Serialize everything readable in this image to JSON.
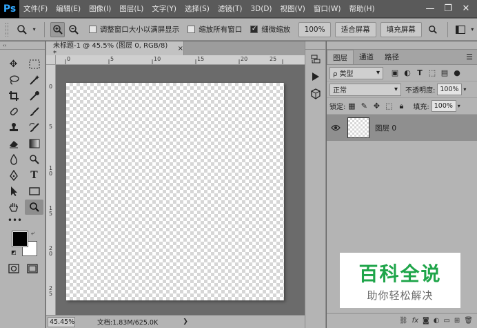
{
  "app": {
    "logo": "Ps"
  },
  "menu": [
    "文件(F)",
    "编辑(E)",
    "图像(I)",
    "图层(L)",
    "文字(Y)",
    "选择(S)",
    "滤镜(T)",
    "3D(D)",
    "视图(V)",
    "窗口(W)",
    "帮助(H)"
  ],
  "window_controls": {
    "minimize": "—",
    "restore": "❐",
    "close": "✕"
  },
  "options": {
    "resize_windows_label": "调整窗口大小以满屏显示",
    "resize_windows_checked": false,
    "zoom_all_label": "缩放所有窗口",
    "zoom_all_checked": false,
    "scrubby_zoom_label": "细微缩放",
    "scrubby_zoom_checked": true,
    "percent_button": "100%",
    "fit_screen_button": "适合屏幕",
    "fill_screen_button": "填充屏幕"
  },
  "document": {
    "tab_title": "未标题-1 @ 45.5% (图层 0, RGB/8) *",
    "tab_close": "×",
    "ruler_top": [
      "0",
      "5",
      "10",
      "15",
      "20",
      "25"
    ],
    "ruler_left": [
      "0",
      "5",
      "1\n0",
      "1\n5",
      "2\n0",
      "2\n5"
    ],
    "zoom": "45.45%",
    "doc_info": "文档:1.83M/625.0K",
    "status_arrow": "❯"
  },
  "layers_panel": {
    "tabs": [
      "图层",
      "通道",
      "路径"
    ],
    "kind_filter": "ρ 类型",
    "blend_mode": "正常",
    "opacity_label": "不透明度:",
    "opacity_value": "100%",
    "lock_label": "锁定:",
    "fill_label": "填充:",
    "fill_value": "100%",
    "layers": [
      {
        "name": "图层 0",
        "visible": true
      }
    ]
  },
  "watermark": {
    "main": "百科全说",
    "sub": "助你轻松解决"
  },
  "colors": {
    "foreground": "#000000",
    "background": "#ffffff",
    "watermark_green": "#1fa54a"
  }
}
